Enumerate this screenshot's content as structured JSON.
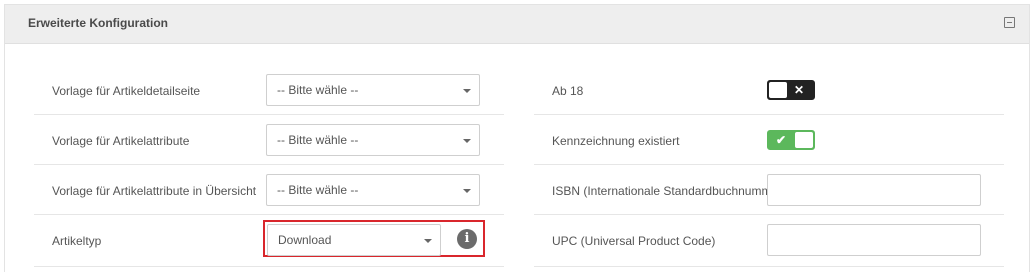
{
  "panel": {
    "title": "Erweiterte Konfiguration",
    "collapse_icon": "minus-square-icon"
  },
  "left": {
    "rows": [
      {
        "label": "Vorlage für Artikeldetailseite",
        "value": "-- Bitte wähle --"
      },
      {
        "label": "Vorlage für Artikelattribute",
        "value": "-- Bitte wähle --"
      },
      {
        "label": "Vorlage für Artikelattribute in Übersicht",
        "value": "-- Bitte wähle --"
      },
      {
        "label": "Artikeltyp",
        "value": "Download"
      }
    ],
    "info_icon": "info-icon",
    "info_glyph": "i"
  },
  "right": {
    "ab18": {
      "label": "Ab 18",
      "state": "off",
      "mark": "✕"
    },
    "kennzeichnung": {
      "label": "Kennzeichnung existiert",
      "state": "on",
      "mark": "✔"
    },
    "isbn": {
      "label": "ISBN (Internationale Standardbuchnumm",
      "value": ""
    },
    "upc": {
      "label": "UPC (Universal Product Code)",
      "value": ""
    }
  },
  "colors": {
    "toggle_on": "#5cb85c",
    "toggle_off": "#222222",
    "highlight": "#d9262c",
    "header_bg": "#eeeeee"
  }
}
